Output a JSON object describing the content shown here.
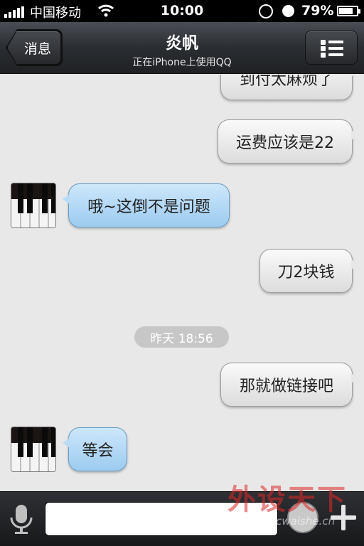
{
  "status_bar": {
    "carrier": "中国移动",
    "time": "10:00",
    "battery_percent": "79%",
    "battery_level": 0.79
  },
  "nav": {
    "back_label": "消息",
    "title": "炎帆",
    "subtitle": "正在iPhone上使用QQ",
    "menu_icon": "list-icon"
  },
  "messages": [
    {
      "side": "out",
      "text": "到付太麻烦了"
    },
    {
      "side": "out",
      "text": "运费应该是22"
    },
    {
      "side": "in",
      "text": "哦~这倒不是问题"
    },
    {
      "side": "out",
      "text": "刀2块钱"
    },
    {
      "side": "out",
      "text": "那就做链接吧"
    },
    {
      "side": "in",
      "text": "等会"
    }
  ],
  "timestamp": "昨天 18:56",
  "input": {
    "value": "",
    "placeholder": ""
  },
  "watermark": {
    "brand": "外设天下",
    "url": "www.pcwaishe.cn"
  },
  "colors": {
    "incoming_bubble": "#a9d3f3",
    "outgoing_bubble": "#f1f1f1",
    "nav_bar": "#2a2d31"
  }
}
